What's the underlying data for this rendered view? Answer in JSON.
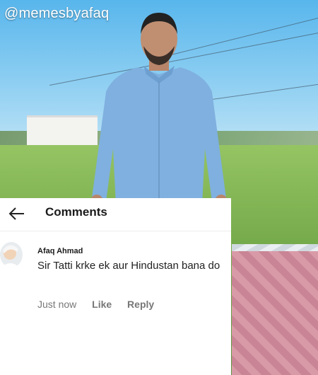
{
  "watermark": "@memesbyafaq",
  "comments_panel": {
    "back_icon": "arrow-left-icon",
    "title": "Comments",
    "comment": {
      "author": "Afaq Ahmad",
      "text": "Sir Tatti krke ek aur Hindustan bana do",
      "time": "Just now",
      "like_label": "Like",
      "reply_label": "Reply"
    }
  },
  "colors": {
    "sky": "#58b6ec",
    "shirt": "#7fb0df",
    "field": "#74a94a",
    "panel_bg": "#ffffff"
  }
}
